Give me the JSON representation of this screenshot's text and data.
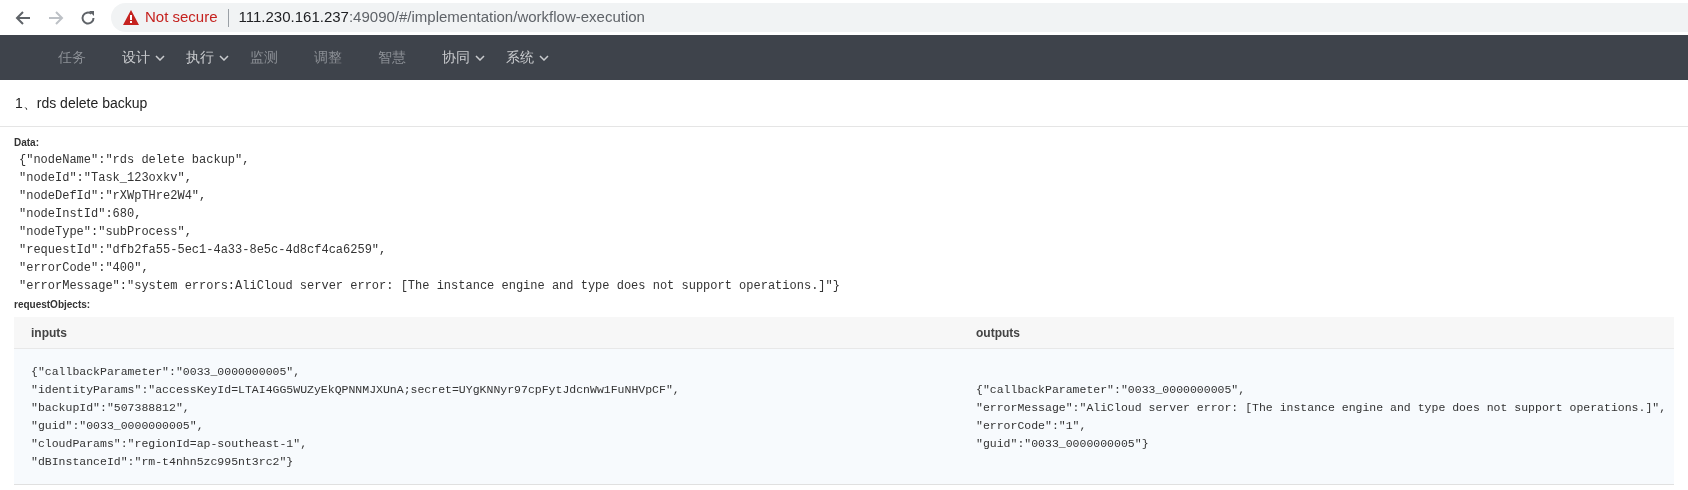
{
  "browser": {
    "security_label": "Not secure",
    "url_host": "111.230.161.237",
    "url_path": ":49090/#/implementation/workflow-execution"
  },
  "nav": {
    "items": [
      {
        "label": "任务",
        "dropdown": false,
        "disabled": true
      },
      {
        "label": "设计",
        "dropdown": true,
        "disabled": false
      },
      {
        "label": "执行",
        "dropdown": true,
        "disabled": false
      },
      {
        "label": "监测",
        "dropdown": false,
        "disabled": true
      },
      {
        "label": "调整",
        "dropdown": false,
        "disabled": true
      },
      {
        "label": "智慧",
        "dropdown": false,
        "disabled": true
      },
      {
        "label": "协同",
        "dropdown": true,
        "disabled": false
      },
      {
        "label": "系统",
        "dropdown": true,
        "disabled": false
      }
    ]
  },
  "page_title": "1、rds delete backup",
  "data": {
    "label": "Data:",
    "lines": [
      "{\"nodeName\":\"rds delete backup\",",
      "\"nodeId\":\"Task_123oxkv\",",
      "\"nodeDefId\":\"rXWpTHre2W4\",",
      "\"nodeInstId\":680,",
      "\"nodeType\":\"subProcess\",",
      "\"requestId\":\"dfb2fa55-5ec1-4a33-8e5c-4d8cf4ca6259\",",
      "\"errorCode\":\"400\",",
      "\"errorMessage\":\"system errors:AliCloud server error: [The instance engine and type does not support operations.]\"}"
    ]
  },
  "request_objects": {
    "label": "requestObjects:",
    "table": {
      "columns": [
        "inputs",
        "outputs"
      ],
      "rows": [
        [
          [
            "{\"callbackParameter\":\"0033_0000000005\",",
            "\"identityParams\":\"accessKeyId=LTAI4GG5WUZyEkQPNNMJXUnA;secret=UYgKNNyr97cpFytJdcnWw1FuNHVpCF\",",
            "\"backupId\":\"507388812\",",
            "\"guid\":\"0033_0000000005\",",
            "\"cloudParams\":\"regionId=ap-southeast-1\",",
            "\"dBInstanceId\":\"rm-t4nhn5zc995nt3rc2\"}"
          ],
          [
            "{\"callbackParameter\":\"0033_0000000005\",",
            "\"errorMessage\":\"AliCloud server error: [The instance engine and type does not support operations.]\",",
            "\"errorCode\":\"1\",",
            "\"guid\":\"0033_0000000005\"}"
          ]
        ]
      ]
    }
  }
}
